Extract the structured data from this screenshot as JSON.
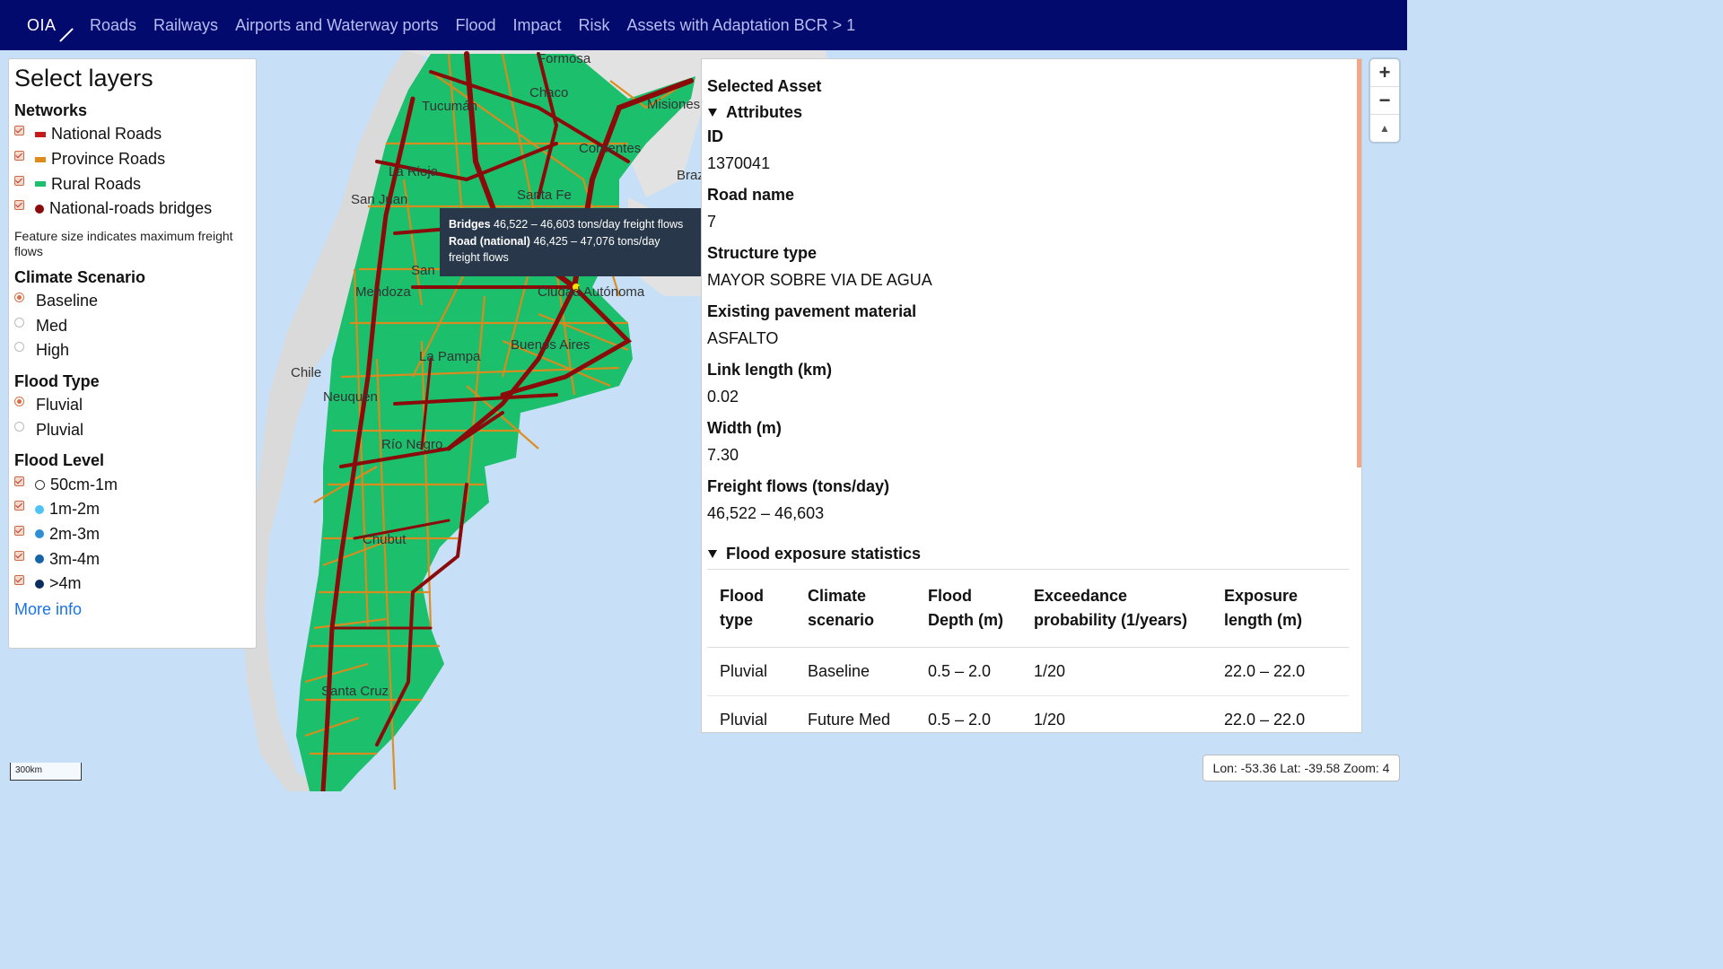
{
  "app": {
    "logo": "OIA"
  },
  "nav": [
    "Roads",
    "Railways",
    "Airports and Waterway ports",
    "Flood",
    "Impact",
    "Risk",
    "Assets with Adaptation BCR > 1"
  ],
  "layers": {
    "title": "Select layers",
    "networks_heading": "Networks",
    "networks": [
      {
        "label": "National Roads",
        "color": "#c41a1a",
        "kind": "line",
        "checked": true
      },
      {
        "label": "Province Roads",
        "color": "#e08a1a",
        "kind": "line",
        "checked": true
      },
      {
        "label": "Rural Roads",
        "color": "#1cbf6b",
        "kind": "line",
        "checked": true
      },
      {
        "label": "National-roads bridges",
        "color": "#8b0a0a",
        "kind": "dot",
        "checked": true
      }
    ],
    "note": "Feature size indicates maximum freight flows",
    "climate_heading": "Climate Scenario",
    "climate": [
      {
        "label": "Baseline",
        "selected": true
      },
      {
        "label": "Med",
        "selected": false
      },
      {
        "label": "High",
        "selected": false
      }
    ],
    "flood_type_heading": "Flood Type",
    "flood_types": [
      {
        "label": "Fluvial",
        "selected": true
      },
      {
        "label": "Pluvial",
        "selected": false
      }
    ],
    "flood_level_heading": "Flood Level",
    "flood_levels": [
      {
        "label": "50cm-1m",
        "color": "#ffffff",
        "checked": true
      },
      {
        "label": "1m-2m",
        "color": "#4fc3f7",
        "checked": true
      },
      {
        "label": "2m-3m",
        "color": "#2f8fd6",
        "checked": true
      },
      {
        "label": "3m-4m",
        "color": "#1565a8",
        "checked": true
      },
      {
        "label": ">4m",
        "color": "#0a2c5e",
        "checked": true
      }
    ],
    "more_info": "More info"
  },
  "tooltip": {
    "line1_bold": "Bridges",
    "line1_text": " 46,522 – 46,603 tons/day freight flows",
    "line2_bold": "Road (national)",
    "line2_text": " 46,425 – 47,076 tons/day freight flows"
  },
  "asset": {
    "title": "Selected Asset",
    "attributes_heading": "Attributes",
    "fields": [
      {
        "label": "ID",
        "value": "1370041"
      },
      {
        "label": "Road name",
        "value": "7"
      },
      {
        "label": "Structure type",
        "value": "MAYOR SOBRE VIA DE AGUA"
      },
      {
        "label": "Existing pavement material",
        "value": "ASFALTO"
      },
      {
        "label": "Link length (km)",
        "value": "0.02"
      },
      {
        "label": "Width (m)",
        "value": "7.30"
      },
      {
        "label": "Freight flows (tons/day)",
        "value": "46,522 – 46,603"
      }
    ],
    "flood_heading": "Flood exposure statistics",
    "table_headers": [
      "Flood type",
      "Climate scenario",
      "Flood Depth (m)",
      "Exceedance probability (1/years)",
      "Exposure length (m)"
    ],
    "table_rows": [
      [
        "Pluvial",
        "Baseline",
        "0.5 – 2.0",
        "1/20",
        "22.0 – 22.0"
      ],
      [
        "Pluvial",
        "Future Med",
        "0.5 – 2.0",
        "1/20",
        "22.0 – 22.0"
      ]
    ]
  },
  "map_labels": [
    "Formosa",
    "Chaco",
    "Misiones",
    "Tucumán",
    "Corrientes",
    "Braz",
    "La Rioja",
    "Santa Fe",
    "San Juan",
    "San",
    "Mendoza",
    "Ciudad Autónoma",
    "Buenos Aires",
    "La Pampa",
    "Chile",
    "Neuquén",
    "Río Negro",
    "Chubut",
    "Santa Cruz"
  ],
  "zoom": {
    "in": "+",
    "out": "−",
    "compass": "▲"
  },
  "coords": "Lon: -53.36 Lat: -39.58 Zoom: 4",
  "scale": "300km"
}
